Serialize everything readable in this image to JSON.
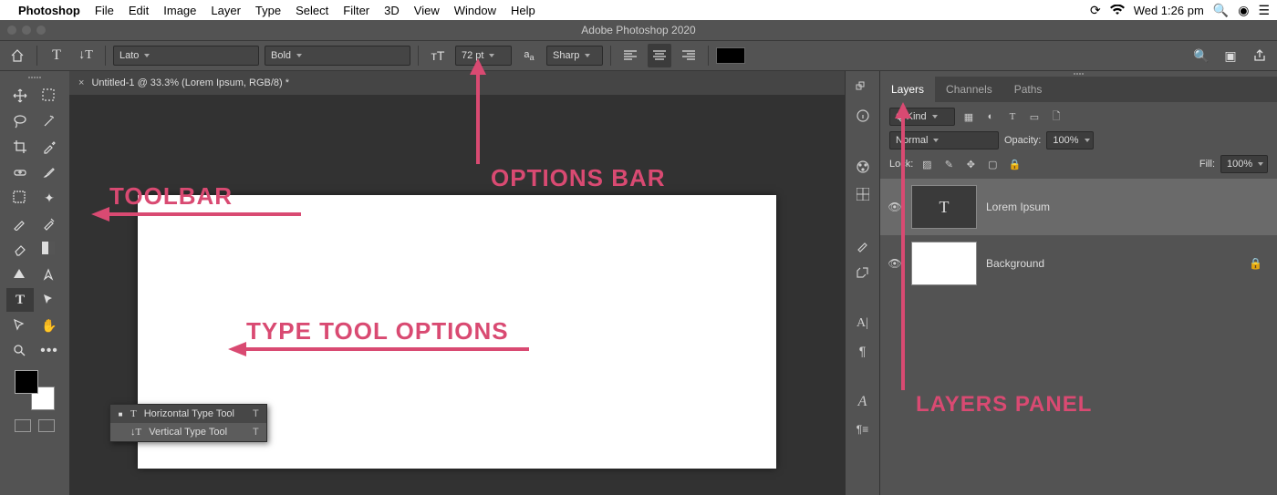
{
  "menubar": {
    "apple": "",
    "app": "Photoshop",
    "items": [
      "File",
      "Edit",
      "Image",
      "Layer",
      "Type",
      "Select",
      "Filter",
      "3D",
      "View",
      "Window",
      "Help"
    ],
    "clock": "Wed 1:26 pm"
  },
  "titlebar": {
    "title": "Adobe Photoshop 2020"
  },
  "options": {
    "font_family": "Lato",
    "font_style": "Bold",
    "font_size": "72 pt",
    "antialias": "Sharp"
  },
  "document": {
    "tab": "Untitled-1 @ 33.3% (Lorem Ipsum, RGB/8) *"
  },
  "type_tool_flyout": {
    "items": [
      {
        "label": "Horizontal Type Tool",
        "key": "T",
        "selected": true
      },
      {
        "label": "Vertical Type Tool",
        "key": "T",
        "selected": false
      }
    ]
  },
  "layers_panel": {
    "tabs": [
      "Layers",
      "Channels",
      "Paths"
    ],
    "active_tab": "Layers",
    "filter": "Q Kind",
    "blend_mode": "Normal",
    "opacity_label": "Opacity:",
    "opacity_value": "100%",
    "lock_label": "Lock:",
    "fill_label": "Fill:",
    "fill_value": "100%",
    "layers": [
      {
        "name": "Lorem Ipsum",
        "type": "text",
        "visible": true,
        "selected": true
      },
      {
        "name": "Background",
        "type": "bg",
        "visible": true,
        "locked": true
      }
    ]
  },
  "annotations": {
    "toolbar": "TOOLBAR",
    "options_bar": "OPTIONS BAR",
    "type_tool_options": "TYPE TOOL OPTIONS",
    "layers_panel": "LAYERS PANEL"
  },
  "colors": {
    "accent": "#d94a72",
    "ui_dark": "#535353",
    "ui_darker": "#323232"
  }
}
